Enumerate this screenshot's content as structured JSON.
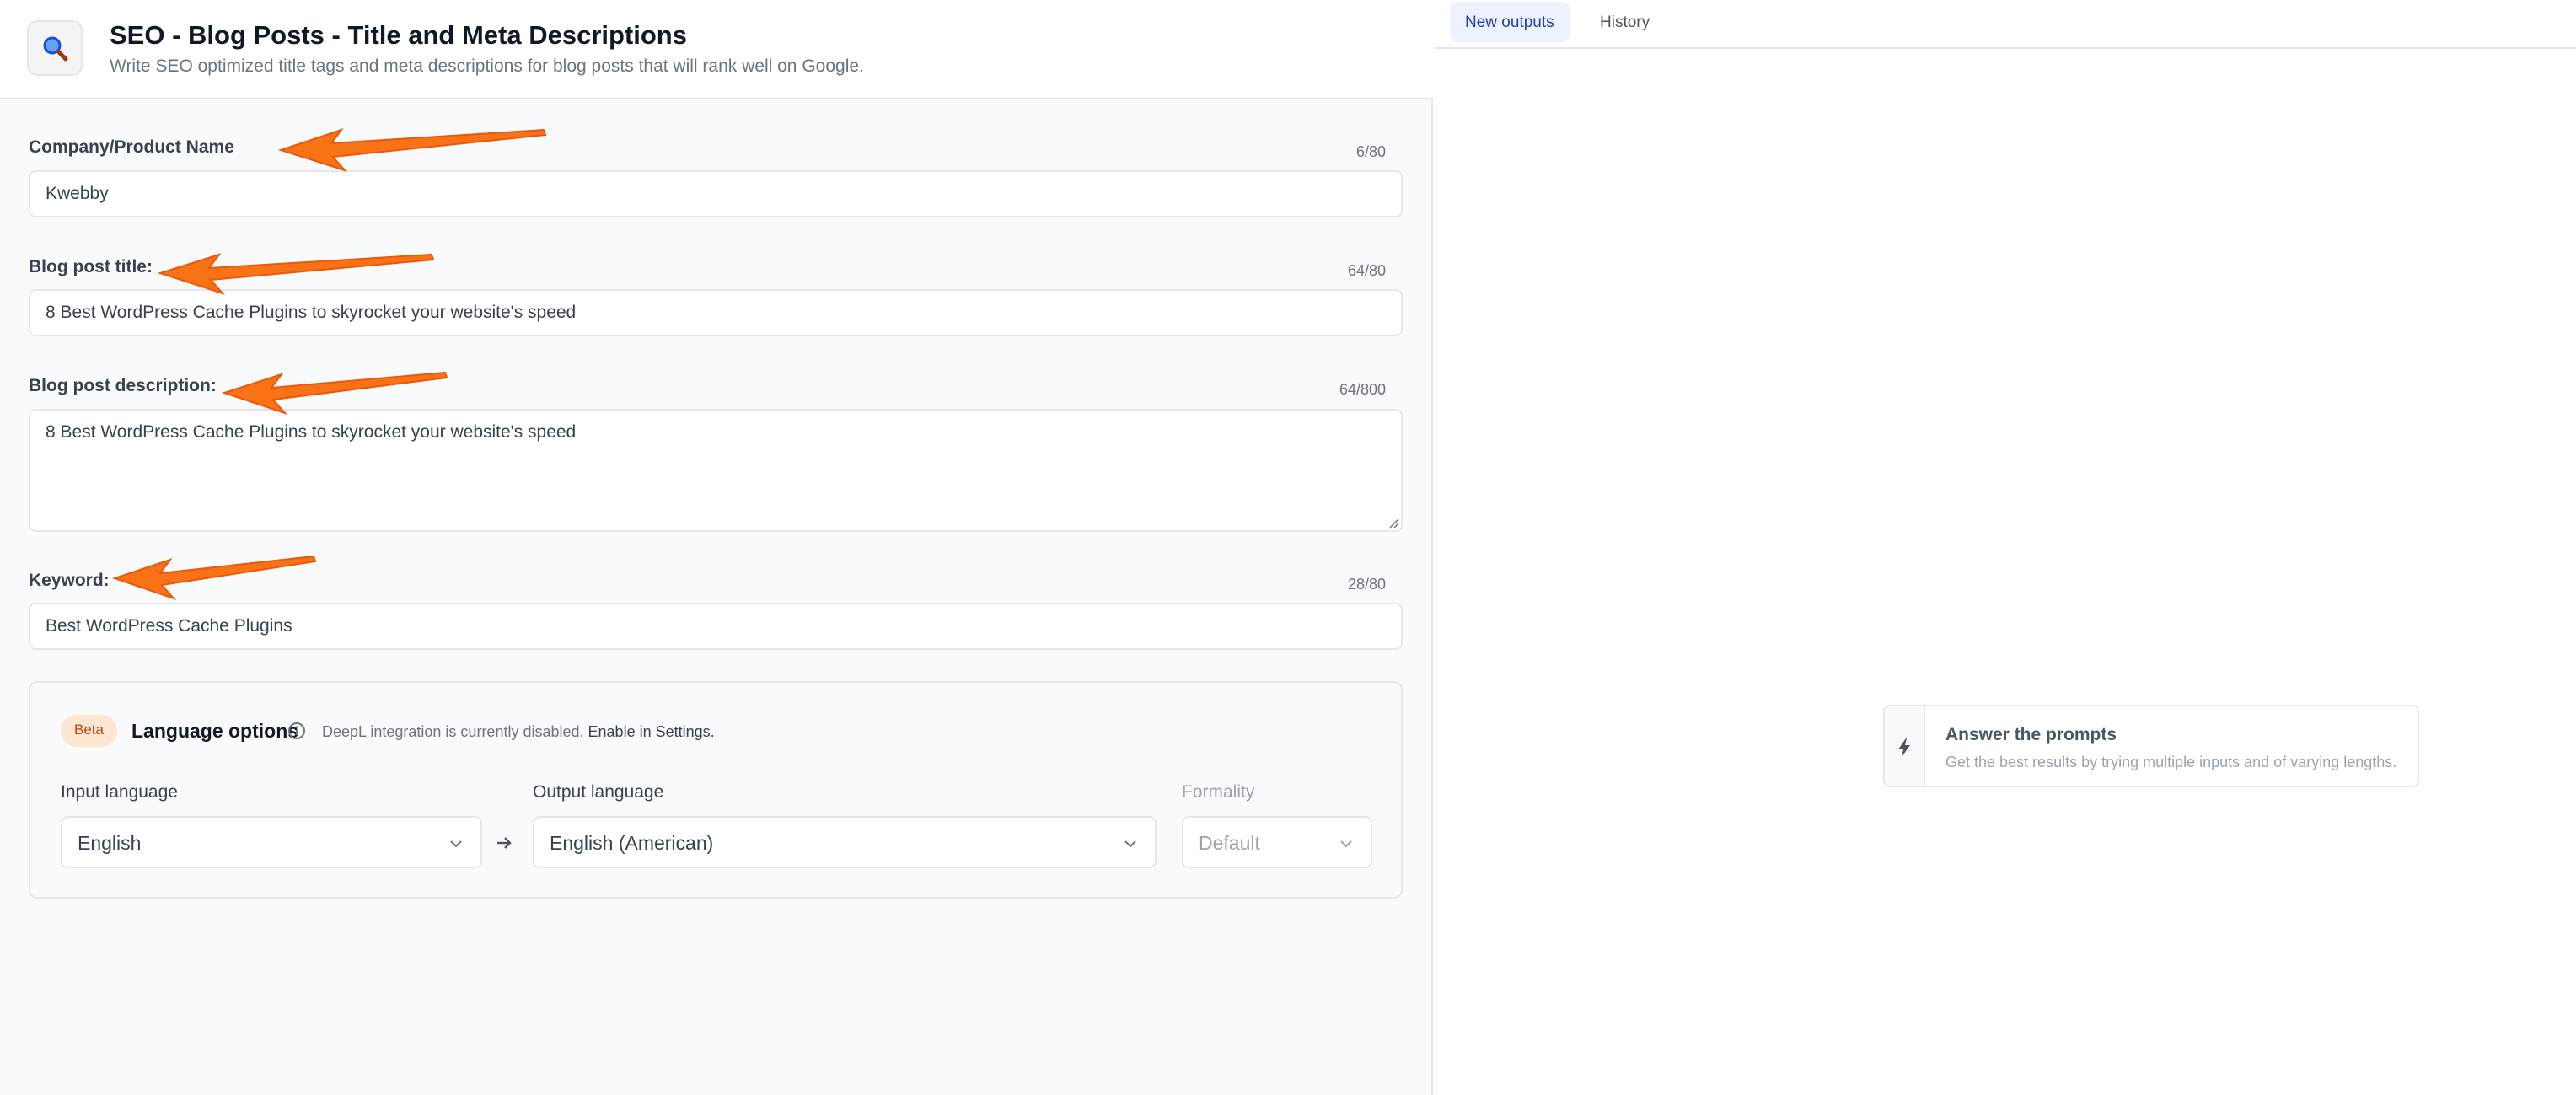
{
  "header": {
    "title": "SEO - Blog Posts - Title and Meta Descriptions",
    "subtitle": "Write SEO optimized title tags and meta descriptions for blog posts that will rank well on Google.",
    "icon": "magnifier-icon"
  },
  "fields": {
    "company": {
      "label": "Company/Product Name",
      "counter": "6/80",
      "value": "Kwebby"
    },
    "title": {
      "label": "Blog post title:",
      "counter": "64/80",
      "value": "8 Best WordPress Cache Plugins to skyrocket your website's speed"
    },
    "description": {
      "label": "Blog post description:",
      "counter": "64/800",
      "value": "8 Best WordPress Cache Plugins to skyrocket your website's speed"
    },
    "keyword": {
      "label": "Keyword:",
      "counter": "28/80",
      "value": "Best WordPress Cache Plugins"
    }
  },
  "language": {
    "badge": "Beta",
    "title": "Language options",
    "note": "DeepL integration is currently disabled.",
    "note_link": "Enable in Settings.",
    "input_label": "Input language",
    "input_value": "English",
    "output_label": "Output language",
    "output_value": "English (American)",
    "formality_label": "Formality",
    "formality_value": "Default"
  },
  "tabs": {
    "new_outputs": "New outputs",
    "history": "History"
  },
  "hint": {
    "title": "Answer the prompts",
    "subtitle": "Get the best results by trying multiple inputs and of varying lengths.",
    "icon": "lightning-icon"
  },
  "colors": {
    "annotation_arrow": "#f97316",
    "beta_badge_bg": "#fde7d3",
    "active_tab_bg": "#eef2ff"
  }
}
